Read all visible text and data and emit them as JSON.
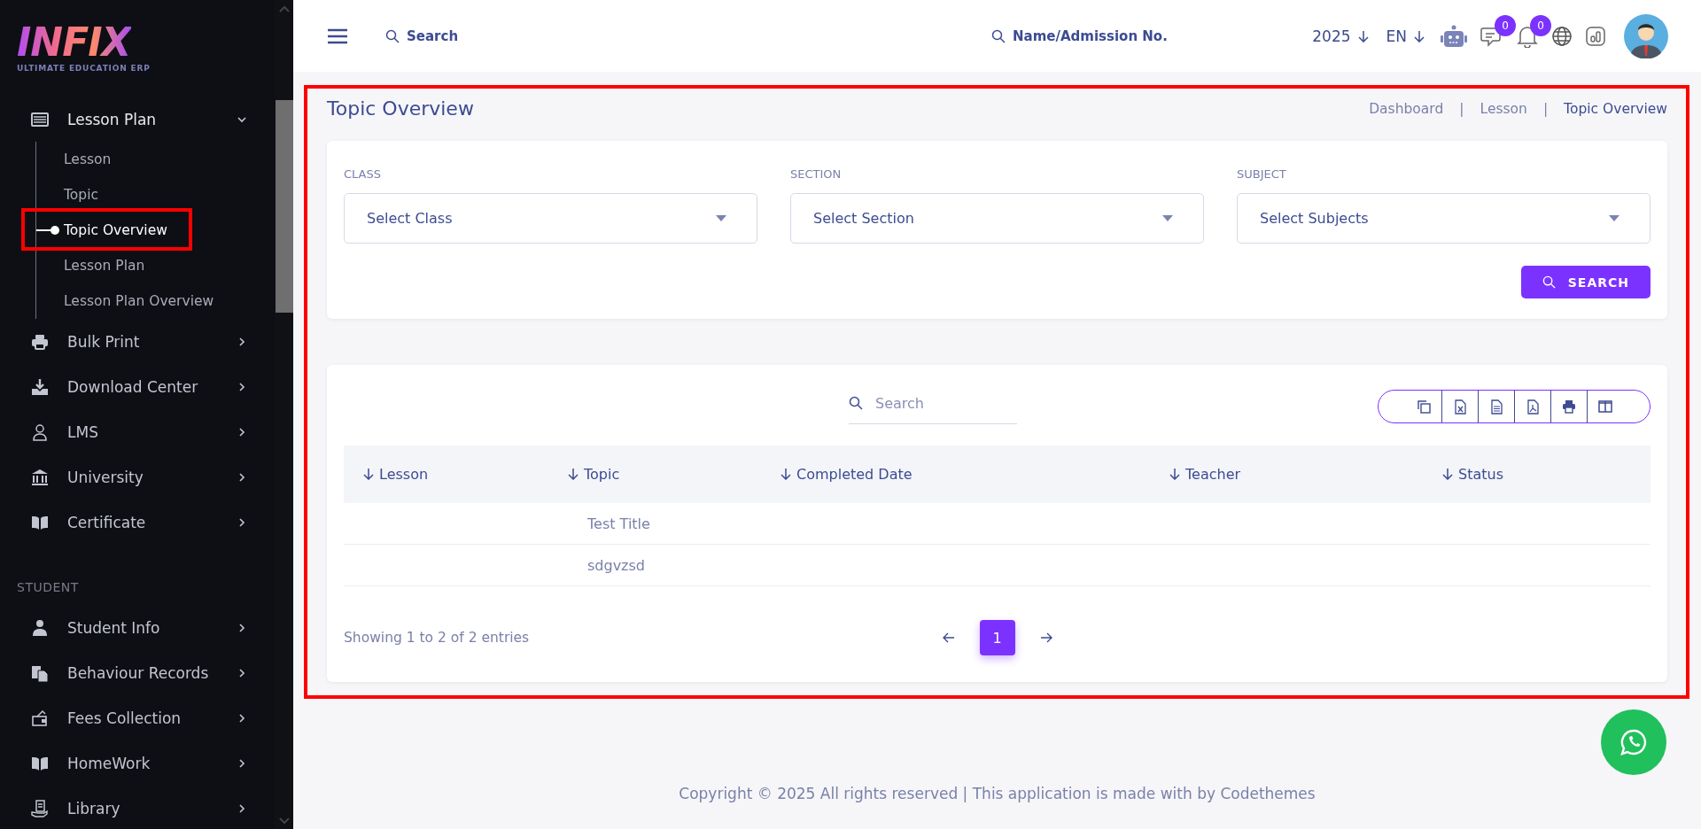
{
  "sidebar": {
    "logo": {
      "wordmark": "INFIX",
      "tagline": "ULTIMATE EDUCATION ERP"
    },
    "sections": [
      {
        "items": [
          {
            "label": "Lesson Plan",
            "expanded": true,
            "children": [
              {
                "label": "Lesson",
                "selected": false
              },
              {
                "label": "Topic",
                "selected": false
              },
              {
                "label": "Topic Overview",
                "selected": true
              },
              {
                "label": "Lesson Plan",
                "selected": false
              },
              {
                "label": "Lesson Plan Overview",
                "selected": false
              }
            ]
          },
          {
            "label": "Bulk Print",
            "expanded": false
          },
          {
            "label": "Download Center",
            "expanded": false
          },
          {
            "label": "LMS",
            "expanded": false
          },
          {
            "label": "University",
            "expanded": false
          },
          {
            "label": "Certificate",
            "expanded": false
          }
        ]
      },
      {
        "heading": "STUDENT",
        "items": [
          {
            "label": "Student Info",
            "expanded": false
          },
          {
            "label": "Behaviour Records",
            "expanded": false
          },
          {
            "label": "Fees Collection",
            "expanded": false
          },
          {
            "label": "HomeWork",
            "expanded": false
          },
          {
            "label": "Library",
            "expanded": false
          }
        ]
      }
    ]
  },
  "header": {
    "search": {
      "placeholder": "Search"
    },
    "student_search": {
      "placeholder": "Name/Admission No."
    },
    "year": "2025",
    "language": "EN",
    "chat_badge": "0",
    "notification_badge": "0"
  },
  "page": {
    "title": "Topic Overview",
    "breadcrumb": [
      {
        "kind": "link",
        "text": "Dashboard"
      },
      {
        "kind": "separator",
        "text": "|"
      },
      {
        "kind": "link",
        "text": "Lesson"
      },
      {
        "kind": "separator",
        "text": "|"
      },
      {
        "kind": "current",
        "text": "Topic Overview"
      }
    ]
  },
  "filters": {
    "fields": [
      {
        "label": "CLASS",
        "placeholder": "Select Class"
      },
      {
        "label": "SECTION",
        "placeholder": "Select Section"
      },
      {
        "label": "SUBJECT",
        "placeholder": "Select Subjects"
      }
    ],
    "button": "SEARCH"
  },
  "table": {
    "search": {
      "placeholder": "Search"
    },
    "columns": [
      {
        "label": "Lesson"
      },
      {
        "label": "Topic"
      },
      {
        "label": "Completed Date"
      },
      {
        "label": "Teacher"
      },
      {
        "label": "Status"
      }
    ],
    "rows": [
      {
        "topic": "Test Title"
      },
      {
        "topic": "sdgvzsd"
      }
    ],
    "info": "Showing 1 to 2 of 2 entries",
    "pages": [
      {
        "label": "1",
        "selected": true
      }
    ]
  },
  "footer": "Copyright © 2025 All rights reserved | This application is made with by Codethemes"
}
